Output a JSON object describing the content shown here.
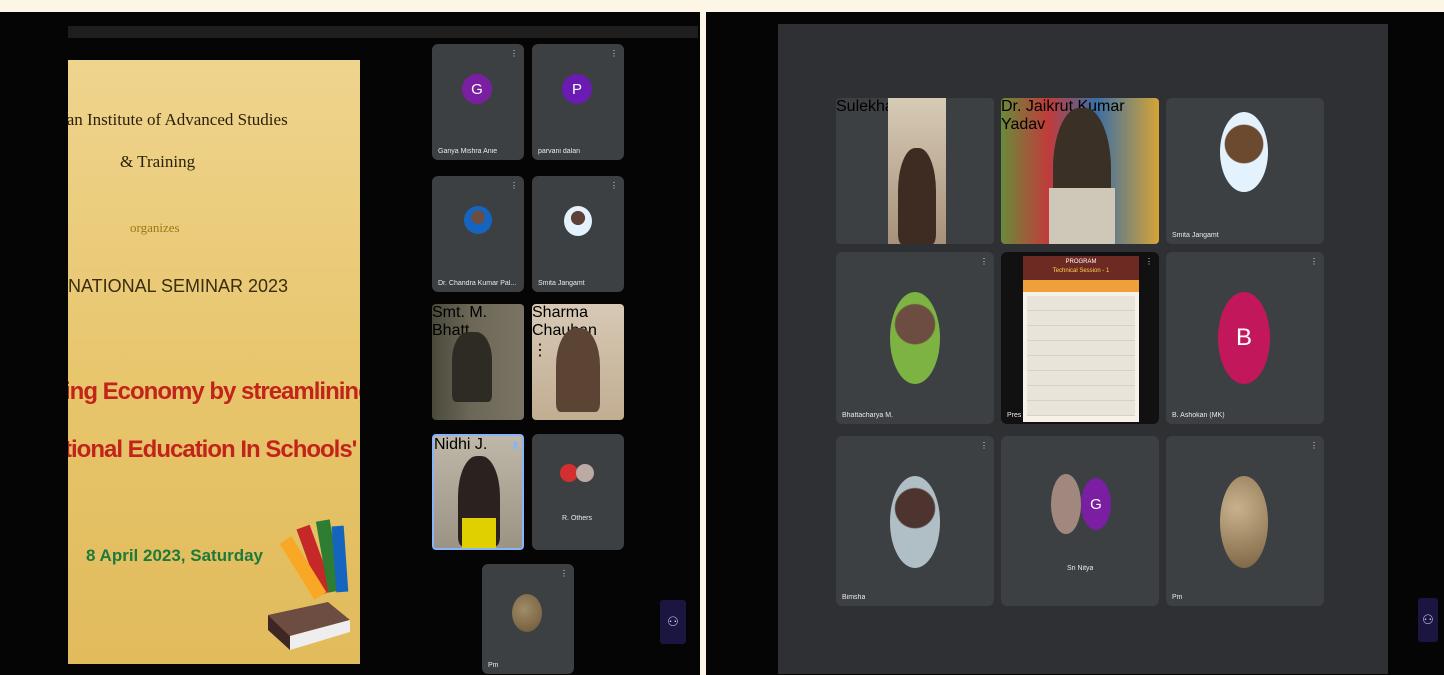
{
  "left": {
    "slide": {
      "line1": "tan Institute of Advanced Studies",
      "line2": "& Training",
      "line3": "organizes",
      "line4": "NATIONAL SEMINAR 2023",
      "line5": "ing Economy by streamlining",
      "line6": "tional Education In Schools'",
      "line7": "8 April 2023, Saturday"
    },
    "tiles": [
      {
        "name": "Ganya Mishra Anie",
        "initial": "G",
        "color": "#7b1fa2"
      },
      {
        "name": "parvani dalan",
        "initial": "P",
        "color": "#6a1bb1"
      },
      {
        "name": "Dr. Chandra Kumar Pal...",
        "initial": "",
        "color": ""
      },
      {
        "name": "Smita Jangamt",
        "initial": "",
        "color": ""
      },
      {
        "name": "Smt. M. Bhatt",
        "initial": "",
        "color": ""
      },
      {
        "name": "Sharma Chauhan",
        "initial": "",
        "color": ""
      },
      {
        "name": "Nidhi J.",
        "initial": "",
        "color": ""
      },
      {
        "name": "R. Others",
        "initial": "",
        "color": ""
      },
      {
        "name": "Pm",
        "initial": "",
        "color": ""
      }
    ],
    "mic_label": "↕"
  },
  "right": {
    "tiles": [
      {
        "name": "Sulekha Singh"
      },
      {
        "name": "Dr. Jaikrut Kumar Yadav"
      },
      {
        "name": "Smita Jangamt"
      },
      {
        "name": "Bhattacharya M."
      },
      {
        "name": "Presentation"
      },
      {
        "name": "B. Ashokan (MK)",
        "initial": "B",
        "color": "#c2185b"
      },
      {
        "name": "Bimsha"
      },
      {
        "name": "Sri Nitya",
        "initial": "G",
        "color": "#7b1fa2"
      },
      {
        "name": "Pm"
      }
    ],
    "presentation": {
      "title": "PROGRAM",
      "subtitle": "Technical Session - 1"
    }
  },
  "colors": {
    "tile_bg": "#3c4043",
    "active_border": "#8ab4f8"
  },
  "icons": {
    "people": "people-icon",
    "pin": "pin-icon"
  }
}
